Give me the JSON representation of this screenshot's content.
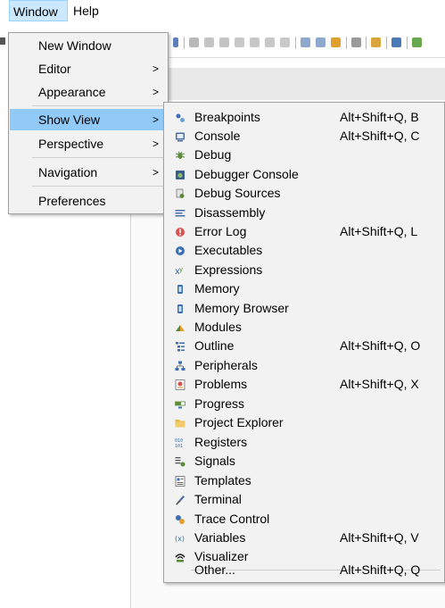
{
  "menubar": {
    "items": [
      {
        "label": "Window",
        "active": true
      },
      {
        "label": "Help",
        "active": false
      }
    ]
  },
  "window_menu": {
    "items": [
      {
        "label": "New Window",
        "submenu": false
      },
      {
        "label": "Editor",
        "submenu": true
      },
      {
        "label": "Appearance",
        "submenu": true
      },
      {
        "label": "Show View",
        "submenu": true,
        "highlighted": true
      },
      {
        "label": "Perspective",
        "submenu": true
      },
      {
        "label": "Navigation",
        "submenu": true
      },
      {
        "label": "Preferences",
        "submenu": false
      }
    ],
    "arrow_glyph": ">"
  },
  "show_view_menu": {
    "items": [
      {
        "label": "Breakpoints",
        "shortcut": "Alt+Shift+Q, B",
        "icon": "breakpoints-icon"
      },
      {
        "label": "Console",
        "shortcut": "Alt+Shift+Q, C",
        "icon": "console-icon"
      },
      {
        "label": "Debug",
        "shortcut": "",
        "icon": "debug-icon"
      },
      {
        "label": "Debugger Console",
        "shortcut": "",
        "icon": "debugger-console-icon"
      },
      {
        "label": "Debug Sources",
        "shortcut": "",
        "icon": "debug-sources-icon"
      },
      {
        "label": "Disassembly",
        "shortcut": "",
        "icon": "disassembly-icon"
      },
      {
        "label": "Error Log",
        "shortcut": "Alt+Shift+Q, L",
        "icon": "error-log-icon"
      },
      {
        "label": "Executables",
        "shortcut": "",
        "icon": "executables-icon"
      },
      {
        "label": "Expressions",
        "shortcut": "",
        "icon": "expressions-icon"
      },
      {
        "label": "Memory",
        "shortcut": "",
        "icon": "memory-icon"
      },
      {
        "label": "Memory Browser",
        "shortcut": "",
        "icon": "memory-browser-icon"
      },
      {
        "label": "Modules",
        "shortcut": "",
        "icon": "modules-icon"
      },
      {
        "label": "Outline",
        "shortcut": "Alt+Shift+Q, O",
        "icon": "outline-icon"
      },
      {
        "label": "Peripherals",
        "shortcut": "",
        "icon": "peripherals-icon"
      },
      {
        "label": "Problems",
        "shortcut": "Alt+Shift+Q, X",
        "icon": "problems-icon"
      },
      {
        "label": "Progress",
        "shortcut": "",
        "icon": "progress-icon"
      },
      {
        "label": "Project Explorer",
        "shortcut": "",
        "icon": "project-explorer-icon"
      },
      {
        "label": "Registers",
        "shortcut": "",
        "icon": "registers-icon"
      },
      {
        "label": "Signals",
        "shortcut": "",
        "icon": "signals-icon"
      },
      {
        "label": "Templates",
        "shortcut": "",
        "icon": "templates-icon"
      },
      {
        "label": "Terminal",
        "shortcut": "",
        "icon": "terminal-icon"
      },
      {
        "label": "Trace Control",
        "shortcut": "",
        "icon": "trace-control-icon"
      },
      {
        "label": "Variables",
        "shortcut": "Alt+Shift+Q, V",
        "icon": "variables-icon"
      },
      {
        "label": "Visualizer",
        "shortcut": "",
        "icon": "visualizer-icon"
      }
    ],
    "other": {
      "label": "Other...",
      "shortcut": "Alt+Shift+Q, Q"
    }
  },
  "colors": {
    "highlight": "#91c9f7",
    "menubar_active": "#cce8ff",
    "menu_background": "#f2f2f2"
  }
}
